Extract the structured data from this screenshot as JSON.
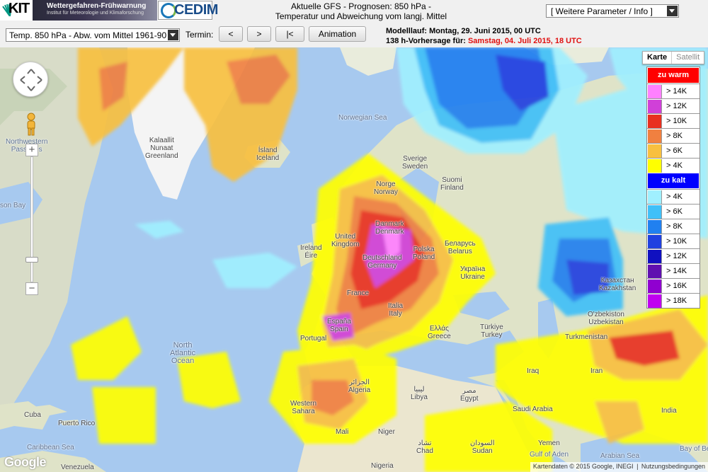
{
  "header": {
    "kit_logo": "KIT",
    "banner_title": "Wettergefahren-Frühwarnung",
    "banner_subtitle": "Institut für Meteorologie und Klimaforschung",
    "cedim_logo": "CEDIM",
    "title_line1": "Aktuelle GFS - Prognosen: 850 hPa -",
    "title_line2": "Temperatur und Abweichung vom langj. Mittel",
    "param_select": "[ Weitere Parameter / Info ]"
  },
  "controls": {
    "field_select": "Temp. 850 hPa - Abw. vom Mittel 1961-90",
    "termin_label": "Termin:",
    "btn_prev": "<",
    "btn_next": ">",
    "btn_first": "|<",
    "btn_animation": "Animation",
    "model_run_label": "Modelllauf: Montag, 29. Juni 2015, 00 UTC",
    "forecast_prefix": "138 h-Vorhersage für: ",
    "forecast_time": "Samstag, 04. Juli 2015, 18 UTC"
  },
  "map": {
    "maptype": {
      "map": "Karte",
      "satellite": "Satellit"
    },
    "attribution": "Kartendaten © 2015 Google, INEGI",
    "terms": "Nutzungsbedingungen",
    "google_logo": "Google",
    "labels": [
      {
        "id": "greenland",
        "text": "Kalaallit\nNunaat\nGreenland"
      },
      {
        "id": "iceland",
        "text": "Ísland\nIceland"
      },
      {
        "id": "norwegian-sea",
        "text": "Norwegian Sea"
      },
      {
        "id": "sweden",
        "text": "Sverige\nSweden"
      },
      {
        "id": "finland",
        "text": "Suomi\nFinland"
      },
      {
        "id": "norway",
        "text": "Norge\nNorway"
      },
      {
        "id": "denmark",
        "text": "Danmark\nDenmark"
      },
      {
        "id": "uk",
        "text": "United\nKingdom"
      },
      {
        "id": "ireland",
        "text": "Ireland\nÉire"
      },
      {
        "id": "germany",
        "text": "Deutschland\nGermany"
      },
      {
        "id": "poland",
        "text": "Polska\nPoland"
      },
      {
        "id": "belarus",
        "text": "Беларусь\nBelarus"
      },
      {
        "id": "ukraine",
        "text": "Україна\nUkraine"
      },
      {
        "id": "france",
        "text": "France"
      },
      {
        "id": "spain",
        "text": "España\nSpain"
      },
      {
        "id": "portugal",
        "text": "Portugal"
      },
      {
        "id": "italy",
        "text": "Italia\nItaly"
      },
      {
        "id": "greece",
        "text": "Ελλάς\nGreece"
      },
      {
        "id": "turkey",
        "text": "Türkiye\nTurkey"
      },
      {
        "id": "kazakhstan",
        "text": "Казахстан\nKazakhstan"
      },
      {
        "id": "uzbekistan",
        "text": "O'zbekiston\nUzbekistan"
      },
      {
        "id": "turkmenistan",
        "text": "Turkmenistan"
      },
      {
        "id": "iran",
        "text": "Iran"
      },
      {
        "id": "iraq",
        "text": "Iraq"
      },
      {
        "id": "saudi",
        "text": "Saudi Arabia"
      },
      {
        "id": "egypt",
        "text": "مصر\nEgypt"
      },
      {
        "id": "libya",
        "text": "ليبيا\nLibya"
      },
      {
        "id": "algeria",
        "text": "الجزائر\nAlgeria"
      },
      {
        "id": "western-sahara",
        "text": "Western\nSahara"
      },
      {
        "id": "mali",
        "text": "Mali"
      },
      {
        "id": "niger",
        "text": "Niger"
      },
      {
        "id": "chad",
        "text": "تشاد\nChad"
      },
      {
        "id": "sudan",
        "text": "السودان\nSudan"
      },
      {
        "id": "nigeria",
        "text": "Nigeria"
      },
      {
        "id": "yemen",
        "text": "Yemen"
      },
      {
        "id": "india",
        "text": "India"
      },
      {
        "id": "north-atlantic",
        "text": "North\nAtlantic\nOcean"
      },
      {
        "id": "hudson-bay",
        "text": "son Bay"
      },
      {
        "id": "nw-passages",
        "text": "Northwestern\nPassages"
      },
      {
        "id": "cuba",
        "text": "Cuba"
      },
      {
        "id": "puerto-rico",
        "text": "Puerto Rico"
      },
      {
        "id": "caribbean",
        "text": "Caribbean Sea"
      },
      {
        "id": "venezuela",
        "text": "Venezuela"
      },
      {
        "id": "gulf-aden",
        "text": "Gulf of Aden"
      },
      {
        "id": "arabian-sea",
        "text": "Arabian Sea"
      },
      {
        "id": "bay-bengal",
        "text": "Bay of Be"
      }
    ]
  },
  "legend": {
    "warm_header": "zu warm",
    "cold_header": "zu kalt",
    "warm_color": "#ff0000",
    "cold_color": "#0000ff",
    "warm": [
      {
        "label": "> 14K",
        "color": "#ff80ff"
      },
      {
        "label": "> 12K",
        "color": "#d040d8"
      },
      {
        "label": "> 10K",
        "color": "#e83020"
      },
      {
        "label": "> 8K",
        "color": "#f08040"
      },
      {
        "label": "> 6K",
        "color": "#f8c040"
      },
      {
        "label": "> 4K",
        "color": "#ffff00"
      }
    ],
    "cold": [
      {
        "label": "> 4K",
        "color": "#a0f0ff"
      },
      {
        "label": "> 6K",
        "color": "#40c0f8"
      },
      {
        "label": "> 8K",
        "color": "#2080f0"
      },
      {
        "label": "> 10K",
        "color": "#2040e0"
      },
      {
        "label": "> 12K",
        "color": "#1010c0"
      },
      {
        "label": "> 14K",
        "color": "#6010b0"
      },
      {
        "label": "> 16K",
        "color": "#9000d0"
      },
      {
        "label": "> 18K",
        "color": "#c000f0"
      }
    ]
  }
}
